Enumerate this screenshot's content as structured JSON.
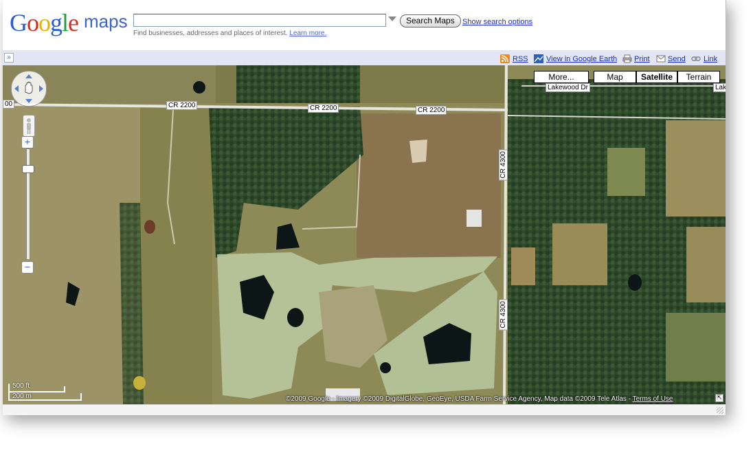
{
  "header": {
    "logo_word": "Google",
    "logo_suffix": "maps",
    "search_value": "",
    "search_button": "Search Maps",
    "search_options_link": "Show search options",
    "hint_text": "Find businesses, addresses and places of interest.",
    "learn_more": "Learn more."
  },
  "toolbar": {
    "expand_glyph": "»",
    "rss": "RSS",
    "google_earth": "View in Google Earth",
    "print": "Print",
    "send": "Send",
    "link": "Link",
    "icons": [
      "rss-icon",
      "earth-icon",
      "printer-icon",
      "envelope-icon",
      "chain-link-icon"
    ]
  },
  "map": {
    "type_buttons": {
      "more": "More...",
      "map": "Map",
      "satellite": "Satellite",
      "terrain": "Terrain",
      "selected": "Satellite"
    },
    "road_labels": {
      "cr2200_a": "CR 2200",
      "cr2200_b": "CR 2200",
      "cr2200_c": "CR 2200",
      "cr4300_a": "CR 4300",
      "cr4300_b": "CR 4300",
      "lakewood": "Lakewood Dr",
      "lak": "Lak",
      "edge": "00"
    },
    "zoom_plus": "+",
    "zoom_minus": "−",
    "scale_imperial": "500 ft",
    "scale_metric": "200 m",
    "copyright": "©2009 Google - Imagery ©2009 DigitalGlobe, GeoEye, USDA Farm Service Agency, Map data ©2009 Tele Atlas - ",
    "terms": "Terms of Use",
    "resize_glyph": "⇱"
  },
  "colors": {
    "link": "#1a2fc9",
    "toolbar_bg": "#e2e6f4",
    "field": "#8b8a55",
    "forest": "#2f4a2a",
    "fairway": "#b9c8a0",
    "pond": "#0d1616"
  }
}
